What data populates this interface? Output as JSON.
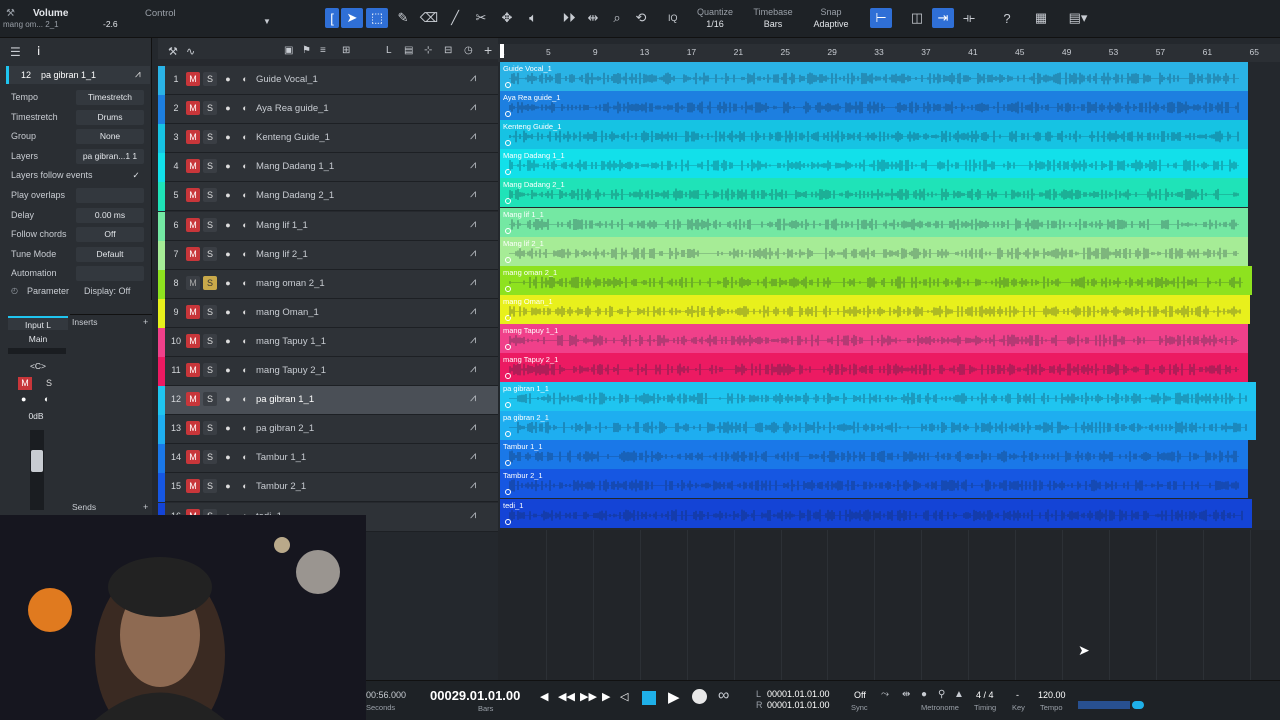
{
  "toolbar": {
    "volume_label": "Volume",
    "control_label": "Control",
    "track_short": "mang om... 2_1",
    "volume_value": "-2.6",
    "quantize_label": "Quantize",
    "quantize_value": "1/16",
    "timebase_label": "Timebase",
    "timebase_value": "Bars",
    "snap_label": "Snap",
    "snap_value": "Adaptive",
    "iq_label": "IQ"
  },
  "inspector": {
    "track_number": "12",
    "track_name": "pa gibran 1_1",
    "rows": [
      {
        "label": "Tempo",
        "value": "Timestretch"
      },
      {
        "label": "Timestretch",
        "value": "Drums"
      },
      {
        "label": "Group",
        "value": "None"
      },
      {
        "label": "Layers",
        "value": "pa gibran...1 1"
      },
      {
        "label": "Layers follow events",
        "value": "✓"
      },
      {
        "label": "Play overlaps",
        "value": ""
      },
      {
        "label": "Delay",
        "value": "0.00 ms"
      },
      {
        "label": "Follow chords",
        "value": "Off"
      },
      {
        "label": "Tune Mode",
        "value": "Default"
      },
      {
        "label": "Automation",
        "value": ""
      }
    ],
    "parameter_label": "Parameter",
    "display_label": "Display: Off"
  },
  "mixer": {
    "input": "Input L",
    "output": "Main",
    "pan": "<C>",
    "mute": "M",
    "solo": "S",
    "level": "0dB",
    "inserts": "Inserts",
    "sends": "Sends"
  },
  "tracks": [
    {
      "num": "1",
      "name": "Guide Vocal_1",
      "clip": "Guide Vocal_1",
      "color": "#2ab3e6",
      "solo": false,
      "mute": true
    },
    {
      "num": "2",
      "name": "Aya Rea guide_1",
      "clip": "Aya Rea guide_1",
      "color": "#1d7fe0",
      "solo": false,
      "mute": true
    },
    {
      "num": "3",
      "name": "Kenteng Guide_1",
      "clip": "Kenteng Guide_1",
      "color": "#16c3e3",
      "solo": false,
      "mute": true
    },
    {
      "num": "4",
      "name": "Mang Dadang 1_1",
      "clip": "Mang Dadang 1_1",
      "color": "#12e0ea",
      "solo": false,
      "mute": true
    },
    {
      "num": "5",
      "name": "Mang Dadang 2_1",
      "clip": "Mang Dadang 2_1",
      "color": "#1fe3b8",
      "solo": false,
      "mute": true
    },
    {
      "num": "6",
      "name": "Mang lif 1_1",
      "clip": "Mang lif 1_1",
      "color": "#74e8a3",
      "solo": false,
      "mute": true
    },
    {
      "num": "7",
      "name": "Mang lif 2_1",
      "clip": "Mang lif 2_1",
      "color": "#a6ec96",
      "solo": false,
      "mute": true
    },
    {
      "num": "8",
      "name": "mang oman 2_1",
      "clip": "mang oman 2_1",
      "color": "#8ee21f",
      "solo": true,
      "mute": false
    },
    {
      "num": "9",
      "name": "mang Oman_1",
      "clip": "mang Oman_1",
      "color": "#e8f01c",
      "solo": false,
      "mute": true
    },
    {
      "num": "10",
      "name": "mang Tapuy 1_1",
      "clip": "mang Tapuy 1_1",
      "color": "#f0408a",
      "solo": false,
      "mute": true
    },
    {
      "num": "11",
      "name": "mang Tapuy 2_1",
      "clip": "mang Tapuy 2_1",
      "color": "#ec1a62",
      "solo": false,
      "mute": true
    },
    {
      "num": "12",
      "name": "pa gibran 1_1",
      "clip": "pa gibran 1_1",
      "color": "#1fc5f0",
      "solo": false,
      "mute": true
    },
    {
      "num": "13",
      "name": "pa gibran 2_1",
      "clip": "pa gibran 2_1",
      "color": "#1eaef0",
      "solo": false,
      "mute": true
    },
    {
      "num": "14",
      "name": "Tambur 1_1",
      "clip": "Tambur 1_1",
      "color": "#1a78e8",
      "solo": false,
      "mute": true
    },
    {
      "num": "15",
      "name": "Tambur 2_1",
      "clip": "Tambur 2_1",
      "color": "#1657e2",
      "solo": false,
      "mute": true
    },
    {
      "num": "16",
      "name": "tedi_1",
      "clip": "tedi_1",
      "color": "#1444d6",
      "solo": false,
      "mute": true
    }
  ],
  "ruler": [
    "1",
    "5",
    "9",
    "13",
    "17",
    "21",
    "25",
    "29",
    "33",
    "37",
    "41",
    "45",
    "49",
    "53",
    "57",
    "61",
    "65"
  ],
  "transport": {
    "time_seconds": "00:56.000",
    "seconds_label": "Seconds",
    "position": "00029.01.01.00",
    "position_label": "Bars",
    "loop_start": "00001.01.01.00",
    "loop_end": "00001.01.01.00",
    "l_label": "L",
    "r_label": "R",
    "sync_value": "Off",
    "sync_label": "Sync",
    "metronome_label": "Metronome",
    "timing_value": "4 / 4",
    "timing_label": "Timing",
    "key_value": "-",
    "key_label": "Key",
    "tempo_value": "120.00",
    "tempo_label": "Tempo"
  }
}
